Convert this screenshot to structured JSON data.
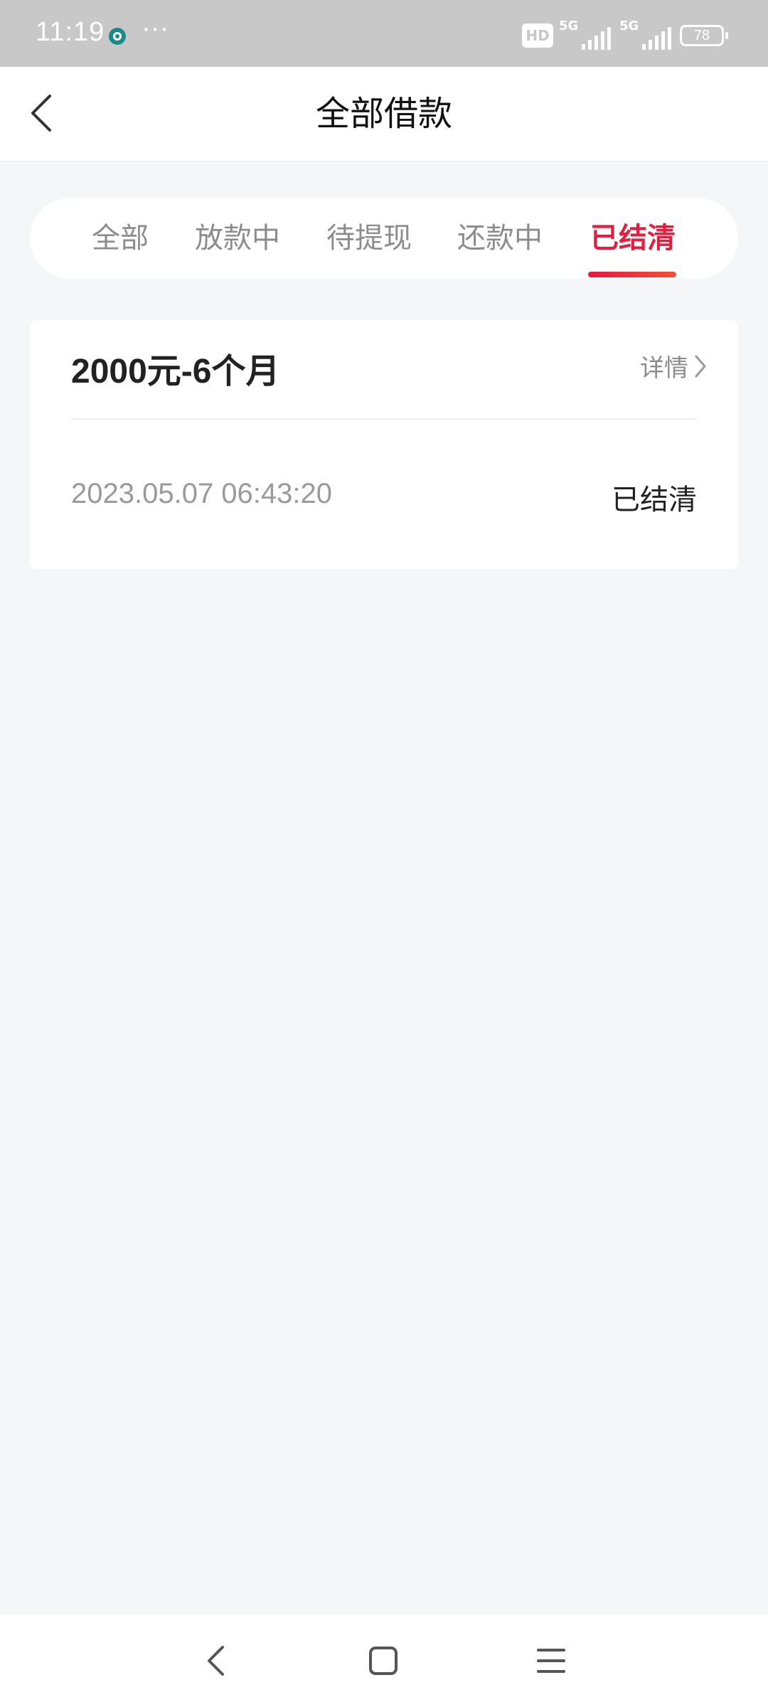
{
  "status_bar": {
    "time": "11:19",
    "more": "···",
    "hd_label": "HD",
    "signal1_label": "5G",
    "signal2_label": "5G",
    "battery": "78"
  },
  "header": {
    "title": "全部借款"
  },
  "tabs": [
    {
      "label": "全部",
      "active": false
    },
    {
      "label": "放款中",
      "active": false
    },
    {
      "label": "待提现",
      "active": false
    },
    {
      "label": "还款中",
      "active": false
    },
    {
      "label": "已结清",
      "active": true
    }
  ],
  "loan_card": {
    "title": "2000元-6个月",
    "detail_label": "详情",
    "date": "2023.05.07 06:43:20",
    "status": "已结清"
  },
  "colors": {
    "accent": "#e41e3f",
    "background": "#f5f6f8",
    "status_bar": "#c8c8c8"
  },
  "icons": {
    "back": "chevron-left-icon",
    "detail": "chevron-right-icon",
    "nav_back": "back-triangle-icon",
    "nav_home": "home-square-icon",
    "nav_menu": "menu-lines-icon"
  }
}
